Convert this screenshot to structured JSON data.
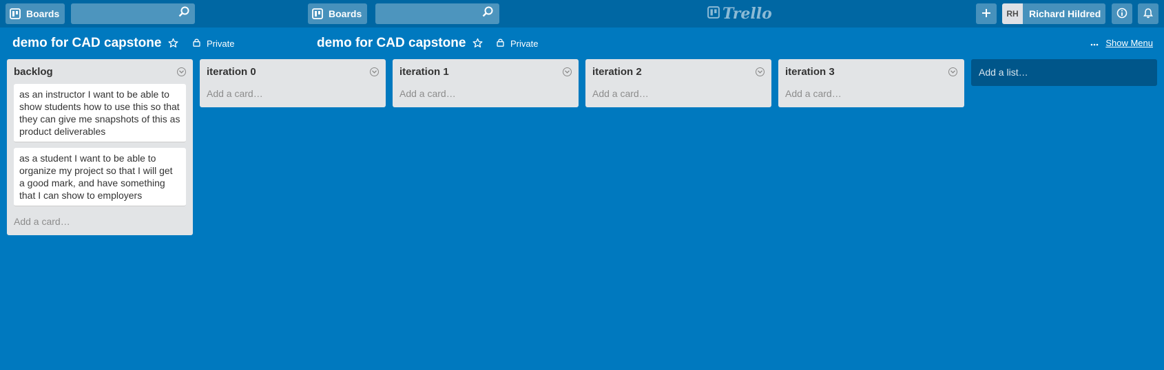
{
  "header": {
    "boards_label": "Boards",
    "boards_label_2": "Boards",
    "logo_text": "Trello",
    "user_initials": "RH",
    "user_name": "Richard Hildred"
  },
  "board": {
    "title": "demo for CAD capstone",
    "title_2": "demo for CAD capstone",
    "visibility": "Private",
    "visibility_2": "Private",
    "show_menu": "Show Menu"
  },
  "lists": [
    {
      "title": "backlog",
      "cards": [
        "as an instructor I want to be able to show students how to use this so that they can give me snapshots of this as product deliverables",
        "as a student I want to be able to organize my project so that I will get a good mark, and have something that I can show to employers"
      ],
      "add_card": "Add a card…"
    },
    {
      "title": "iteration 0",
      "cards": [],
      "add_card": "Add a card…"
    },
    {
      "title": "iteration 1",
      "cards": [],
      "add_card": "Add a card…"
    },
    {
      "title": "iteration 2",
      "cards": [],
      "add_card": "Add a card…"
    },
    {
      "title": "iteration 3",
      "cards": [],
      "add_card": "Add a card…"
    }
  ],
  "add_list": "Add a list…",
  "icons": {
    "boards": "boards-icon",
    "search": "search-icon",
    "star": "star-icon",
    "lock": "lock-icon",
    "ellipsis": "ellipsis-icon",
    "plus": "plus-icon",
    "info": "info-icon",
    "bell": "bell-icon",
    "chevron": "chevron-down-icon"
  },
  "colors": {
    "background": "#0079BF",
    "header": "#0067A3",
    "list": "#E2E4E6",
    "add_list": "#00568A"
  }
}
